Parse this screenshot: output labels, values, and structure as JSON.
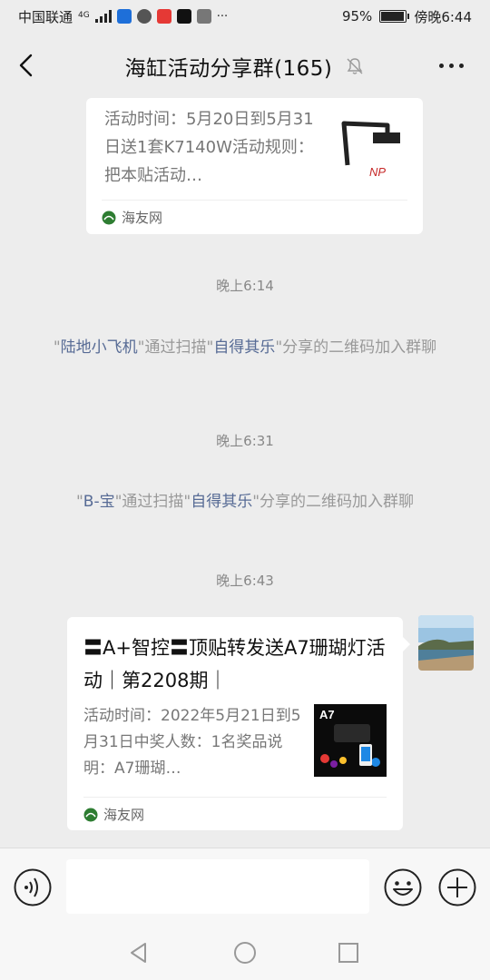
{
  "status_bar": {
    "carrier": "中国联通",
    "network": "4G",
    "battery_text": "95%",
    "time": "傍晚6:44",
    "more_dots": "···"
  },
  "header": {
    "title": "海缸活动分享群(165)"
  },
  "messages": {
    "card1": {
      "desc": "活动时间：5月20日到5月31日送1套K7140W活动规则：把本贴活动…",
      "thumb_text": "NP",
      "source": "海友网"
    },
    "time1": "晚上6:14",
    "sys1": {
      "quote_open": "\"",
      "user": "陆地小飞机",
      "mid": "\"通过扫描\"",
      "inviter": "自得其乐",
      "tail": "\"分享的二维码加入群聊"
    },
    "time2": "晚上6:31",
    "sys2": {
      "quote_open": "\"",
      "user": "B-宝",
      "mid": "\"通过扫描\"",
      "inviter": "自得其乐",
      "tail": "\"分享的二维码加入群聊"
    },
    "time3": "晚上6:43",
    "card2": {
      "title": "〓A+智控〓顶贴转发送A7珊瑚灯活动｜第2208期｜",
      "desc": "活动时间：2022年5月21日到5月31日中奖人数：1名奖品说明：A7珊瑚…",
      "thumb_text": "A7",
      "source": "海友网"
    }
  },
  "icons": {
    "back": "chevron-left-icon",
    "mute": "bell-off-icon",
    "more": "more-dots-icon",
    "voice": "voice-icon",
    "emoji": "emoji-icon",
    "plus": "plus-icon"
  },
  "colors": {
    "background": "#ededed",
    "link": "#576b95",
    "card": "#ffffff"
  }
}
